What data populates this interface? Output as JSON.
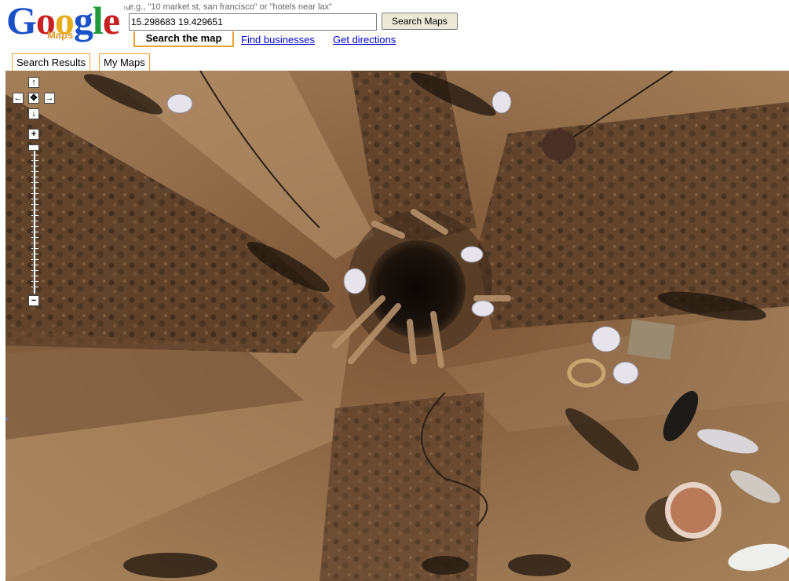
{
  "header": {
    "logo_text": "Google",
    "logo_sub": "Maps",
    "logo_tm": "TM",
    "search": {
      "hint": "e.g., \"10 market st, san francisco\" or \"hotels near lax\"",
      "value": "15.298683 19.429651",
      "button_label": "Search Maps"
    },
    "tabs": [
      {
        "label": "Search the map",
        "active": true
      },
      {
        "label": "Find businesses",
        "active": false
      },
      {
        "label": "Get directions",
        "active": false
      }
    ]
  },
  "panel_tabs": [
    {
      "label": "Search Results"
    },
    {
      "label": "My Maps"
    }
  ],
  "map": {
    "type": "satellite",
    "controls": {
      "pan_up": "↑",
      "pan_left": "←",
      "pan_center": "✥",
      "pan_right": "→",
      "pan_down": "↓",
      "zoom_in": "+",
      "zoom_out": "−"
    },
    "side_arrow": "▸"
  },
  "colors": {
    "tab_border": "#f0a030",
    "link": "#0000cc",
    "logo_blue": "#1a51c8",
    "logo_red": "#c8201e",
    "logo_yellow": "#e8ac1a",
    "logo_green": "#1f9a3a"
  }
}
